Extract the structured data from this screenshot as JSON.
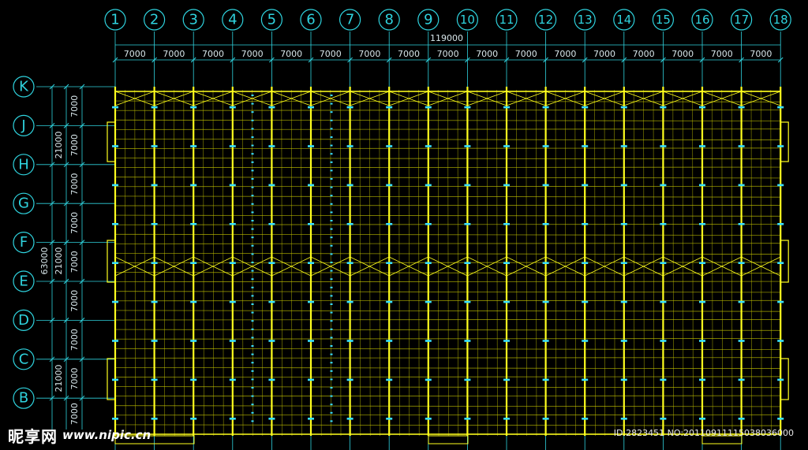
{
  "column_axes": [
    "1",
    "2",
    "3",
    "4",
    "5",
    "6",
    "7",
    "8",
    "9",
    "10",
    "11",
    "12",
    "13",
    "14",
    "15",
    "16",
    "17",
    "18"
  ],
  "row_axes": [
    "K",
    "J",
    "H",
    "G",
    "F",
    "E",
    "D",
    "C",
    "B"
  ],
  "dims": {
    "total_width": "119000",
    "bay_width": "7000",
    "row_spacing": "7000",
    "group_upper": "21000",
    "group_lower": "21000",
    "total_depth": "63000"
  },
  "colors": {
    "background": "#000000",
    "axis": "#2fd3de",
    "frame": "#ffff1e",
    "purlin": "#c8c800",
    "marker": "#39e0ff",
    "text": "#d7e6ea"
  },
  "watermark": {
    "logo": "昵享网",
    "url": "www.nipic.cn",
    "id_text": "ID:2823451 NO:20110911115038036000"
  }
}
